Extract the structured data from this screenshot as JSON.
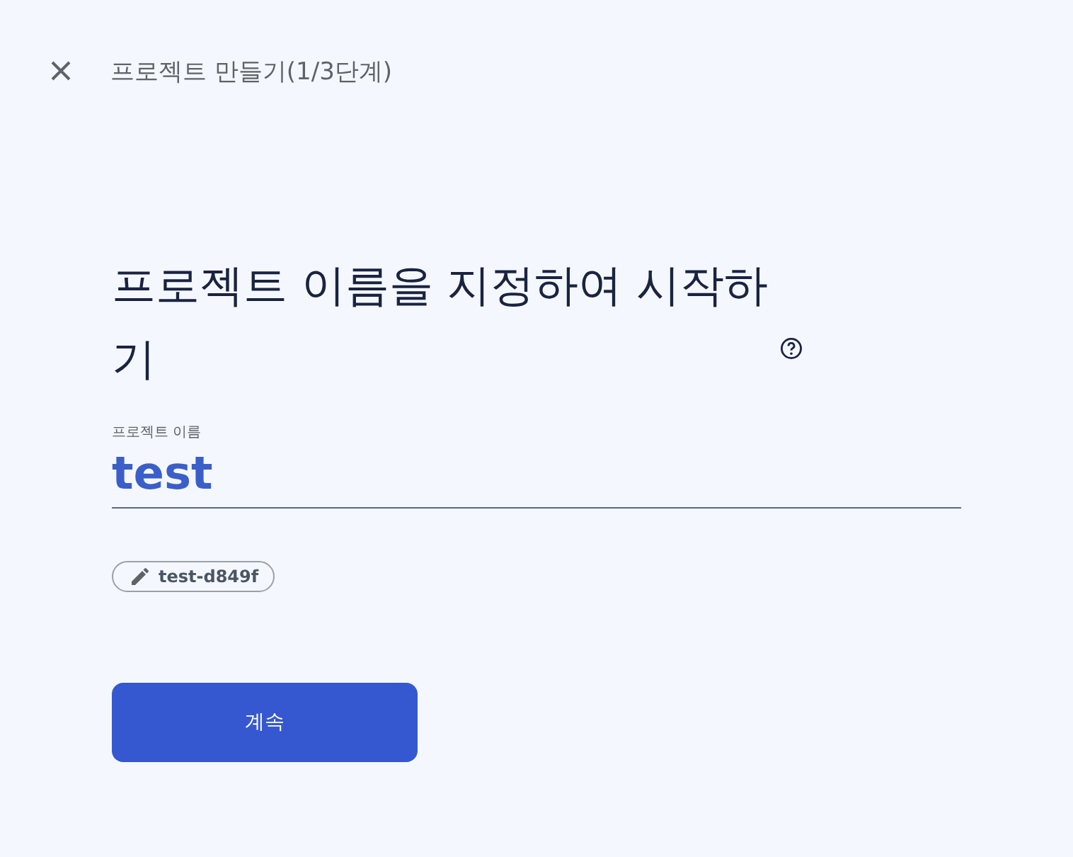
{
  "header": {
    "title": "프로젝트 만들기(1/3단계)"
  },
  "heading": "프로젝트 이름을 지정하여 시작하기",
  "name_field": {
    "label": "프로젝트 이름",
    "value": "test"
  },
  "project_id_chip": "test-d849f",
  "buttons": [
    "계속"
  ]
}
